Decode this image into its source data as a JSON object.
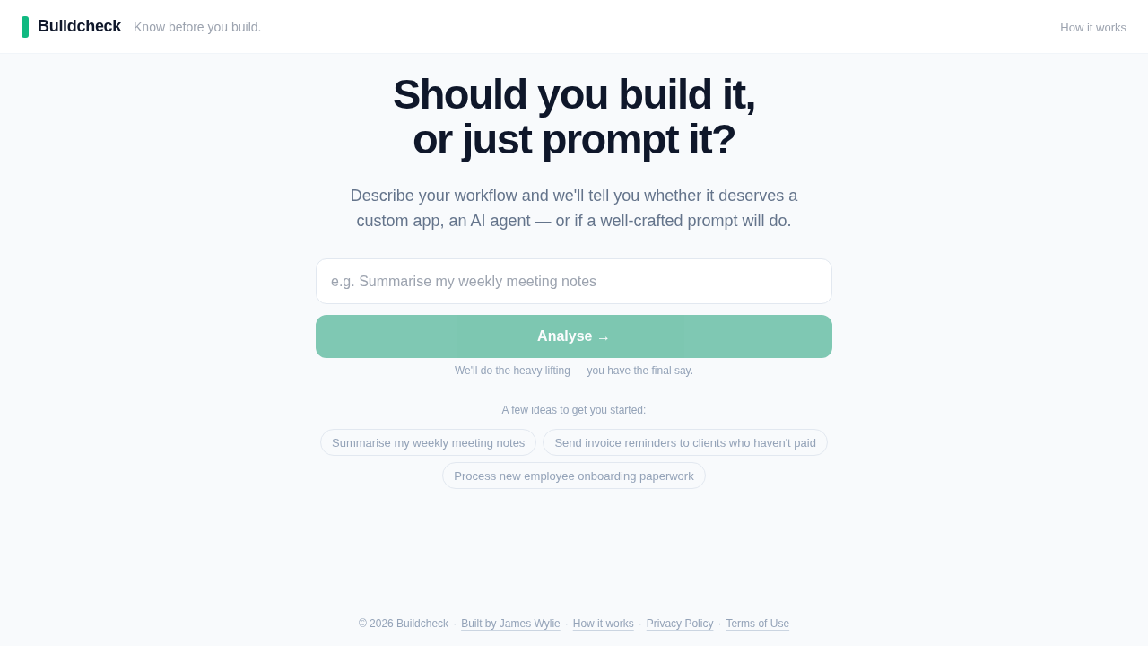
{
  "header": {
    "brand": "Buildcheck",
    "tagline": "Know before you build.",
    "nav": [
      {
        "label": "How it works"
      }
    ]
  },
  "hero": {
    "title": "Should you build it,\nor just prompt it?",
    "subtitle": "Describe your workflow and we'll tell you whether it deserves a custom app, an AI agent — or if a well-crafted prompt will do."
  },
  "form": {
    "input": {
      "placeholder": "e.g. Summarise my weekly meeting notes"
    },
    "button": {
      "label": "Analyse →",
      "disabled": true
    },
    "note": "We'll do the heavy lifting — you have the final say."
  },
  "ideas": {
    "label": "A few ideas to get you started:",
    "chips": [
      "Summarise my weekly meeting notes",
      "Send invoice reminders to clients who haven't paid",
      "Process new employee onboarding paperwork"
    ]
  },
  "footer": {
    "items": [
      {
        "kind": "text",
        "text": "© 2026 Buildcheck"
      },
      {
        "kind": "separator",
        "text": "·"
      },
      {
        "kind": "link",
        "text": "Built by James Wylie"
      },
      {
        "kind": "separator",
        "text": "·"
      },
      {
        "kind": "link",
        "text": "How it works"
      },
      {
        "kind": "separator",
        "text": "·"
      },
      {
        "kind": "link",
        "text": "Privacy Policy"
      },
      {
        "kind": "separator",
        "text": "·"
      },
      {
        "kind": "link",
        "text": "Terms of Use"
      }
    ]
  }
}
